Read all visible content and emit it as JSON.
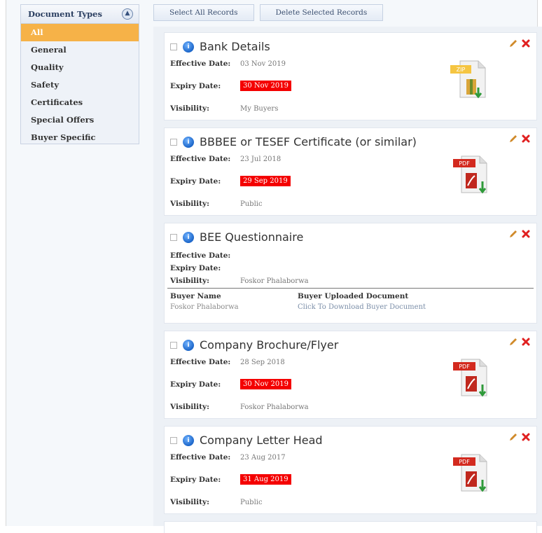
{
  "sidebar": {
    "title": "Document Types",
    "items": [
      {
        "label": "All",
        "active": true
      },
      {
        "label": "General"
      },
      {
        "label": "Quality"
      },
      {
        "label": "Safety"
      },
      {
        "label": "Certificates"
      },
      {
        "label": "Special Offers"
      },
      {
        "label": "Buyer Specific"
      }
    ]
  },
  "toolbar": {
    "select_all_label": "Select All Records",
    "delete_selected_label": "Delete Selected Records"
  },
  "labels": {
    "effective_date": "Effective Date:",
    "expiry_date": "Expiry Date:",
    "visibility": "Visibility:",
    "buyer_name": "Buyer Name",
    "buyer_uploaded_document": "Buyer Uploaded Document"
  },
  "records": [
    {
      "title": "Bank Details",
      "effective_date": "03 Nov 2019",
      "expiry_date": "30 Nov 2019",
      "visibility": "My Buyers",
      "file_type": "ZIP"
    },
    {
      "title": "BBBEE or TESEF Certificate (or similar)",
      "effective_date": "23 Jul 2018",
      "expiry_date": "29 Sep 2019",
      "visibility": "Public",
      "file_type": "PDF"
    },
    {
      "title": "BEE Questionnaire",
      "effective_date": "",
      "expiry_date": "",
      "visibility": "Foskor Phalaborwa",
      "buyer_name": "Foskor Phalaborwa",
      "buyer_document_link": "Click To Download Buyer Document"
    },
    {
      "title": "Company Brochure/Flyer",
      "effective_date": "28 Sep 2018",
      "expiry_date": "30 Nov 2019",
      "visibility": "Foskor Phalaborwa",
      "file_type": "PDF"
    },
    {
      "title": "Company Letter Head",
      "effective_date": "23 Aug 2017",
      "expiry_date": "31 Aug 2019",
      "visibility": "Public",
      "file_type": "PDF"
    }
  ],
  "colors": {
    "active_item": "#f6b248",
    "expired_badge": "#f40000",
    "info_icon": "#1c66c9",
    "delete_icon": "#e02020",
    "edit_icon": "#d08a2a"
  },
  "icons": {
    "collapse": "chevron-up-icon",
    "info": "info-icon",
    "edit": "pencil-icon",
    "delete": "x-icon",
    "file_pdf": "pdf-file-icon",
    "file_zip": "zip-file-icon"
  }
}
